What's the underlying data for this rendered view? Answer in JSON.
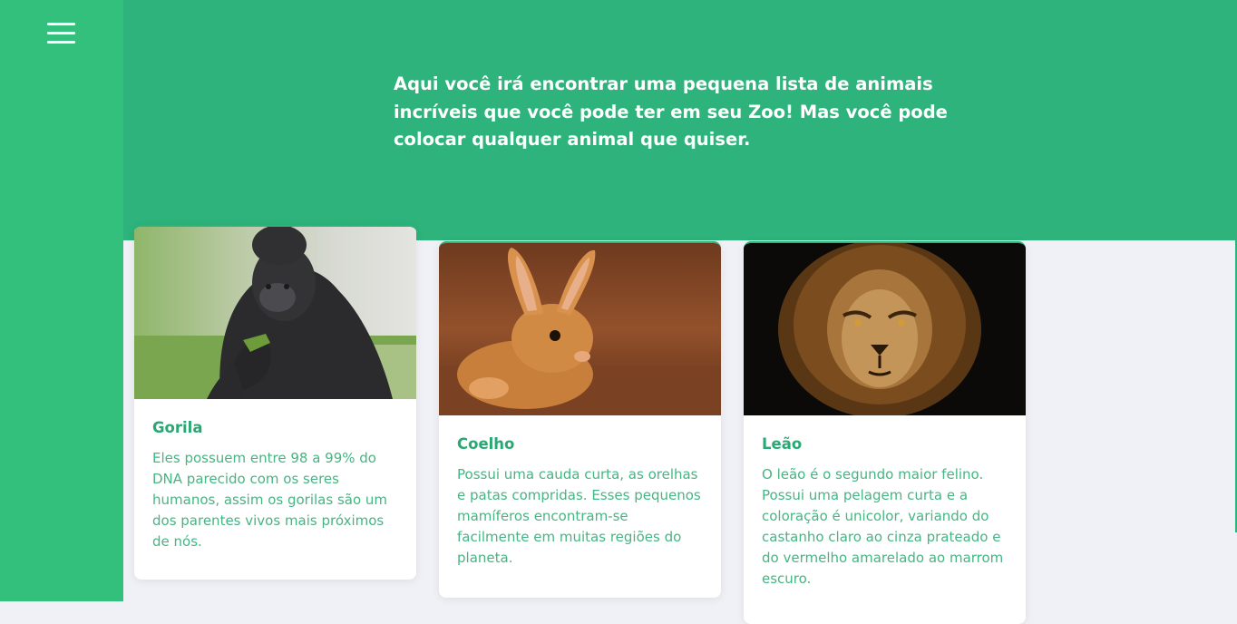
{
  "menu": {
    "icon": "hamburger-menu-icon"
  },
  "hero": {
    "text": "Aqui você irá encontrar uma pequena lista de animais incríveis que você pode ter em seu Zoo! Mas você pode colocar qualquer animal que quiser."
  },
  "colors": {
    "sidebar": "#33c07c",
    "hero": "#2db37b",
    "accent_text": "#2aa874",
    "body_text": "#46b583",
    "background": "#f0f1f6"
  },
  "cards": [
    {
      "title": "Gorila",
      "text": "Eles possuem entre 98 a 99% do DNA parecido com os seres humanos, assim os gorilas são um dos parentes vivos mais próximos de nós."
    },
    {
      "title": "Coelho",
      "text": "Possui uma cauda curta, as orelhas e patas compridas. Esses pequenos mamíferos encontram-se facilmente em muitas regiões do planeta."
    },
    {
      "title": "Leão",
      "text": "O leão é o segundo maior felino. Possui uma pelagem curta e a coloração é unicolor, variando do castanho claro ao cinza prateado e do vermelho amarelado ao marrom escuro."
    }
  ]
}
